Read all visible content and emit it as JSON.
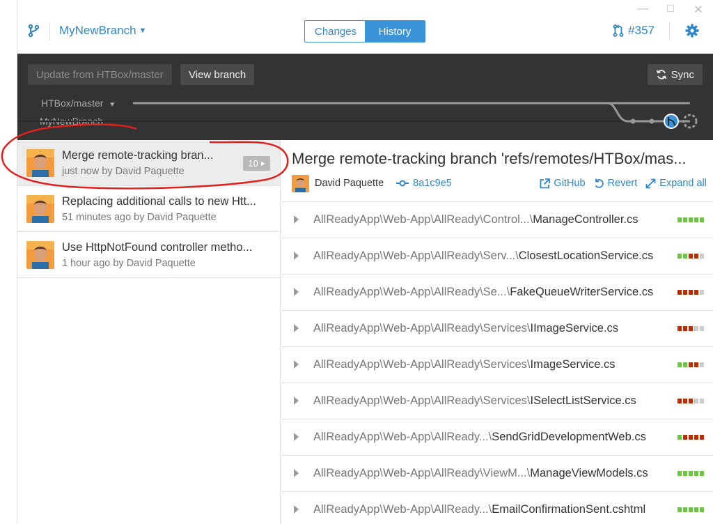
{
  "header": {
    "branch": "MyNewBranch",
    "tabs": [
      "Changes",
      "History"
    ],
    "active_tab": "History",
    "pr_number": "#357"
  },
  "toolbar": {
    "update_label": "Update from HTBox/master",
    "view_branch_label": "View branch",
    "sync_label": "Sync",
    "base_branch": "HTBox/master",
    "current_branch": "MyNewBranch"
  },
  "commits": [
    {
      "title": "Merge remote-tracking bran...",
      "sub": "just now by David Paquette",
      "badge": "10"
    },
    {
      "title": "Replacing additional calls to new Htt...",
      "sub": "51 minutes ago by David Paquette"
    },
    {
      "title": "Use HttpNotFound controller metho...",
      "sub": "1 hour ago by David Paquette"
    }
  ],
  "detail": {
    "title": "Merge remote-tracking branch 'refs/remotes/HTBox/mas...",
    "author": "David Paquette",
    "sha": "8a1c9e5",
    "actions": {
      "github": "GitHub",
      "revert": "Revert",
      "expand": "Expand all"
    }
  },
  "files": [
    {
      "dir": "AllReadyApp\\Web-App\\AllReady\\Control...\\",
      "name": "ManageController.cs",
      "stat": "ggggg"
    },
    {
      "dir": "AllReadyApp\\Web-App\\AllReady\\Serv...\\",
      "name": "ClosestLocationService.cs",
      "stat": "ggrrn"
    },
    {
      "dir": "AllReadyApp\\Web-App\\AllReady\\Se...\\",
      "name": "FakeQueueWriterService.cs",
      "stat": "rrrrn"
    },
    {
      "dir": "AllReadyApp\\Web-App\\AllReady\\Services\\",
      "name": "IImageService.cs",
      "stat": "rrrnn"
    },
    {
      "dir": "AllReadyApp\\Web-App\\AllReady\\Services\\",
      "name": "ImageService.cs",
      "stat": "ggrrn"
    },
    {
      "dir": "AllReadyApp\\Web-App\\AllReady\\Services\\",
      "name": "ISelectListService.cs",
      "stat": "rrrnn"
    },
    {
      "dir": "AllReadyApp\\Web-App\\AllReady...\\",
      "name": "SendGridDevelopmentWeb.cs",
      "stat": "grrrr"
    },
    {
      "dir": "AllReadyApp\\Web-App\\AllReady\\ViewM...\\",
      "name": "ManageViewModels.cs",
      "stat": "ggggg"
    },
    {
      "dir": "AllReadyApp\\Web-App\\AllReady...\\",
      "name": "EmailConfirmationSent.cshtml",
      "stat": "ggggg"
    }
  ],
  "colors": {
    "accent": "#3a93d8",
    "toolbar_bg": "#333333",
    "annotation": "#e0201b"
  }
}
